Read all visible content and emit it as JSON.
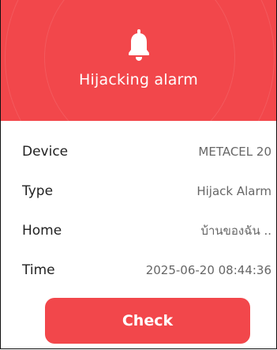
{
  "header": {
    "icon": "bell-icon",
    "title": "Hijacking alarm",
    "color": "#f2474b"
  },
  "details": {
    "device": {
      "label": "Device",
      "value": "METACEL 20"
    },
    "type": {
      "label": "Type",
      "value": "Hijack Alarm"
    },
    "home": {
      "label": "Home",
      "value": "บ้านของฉัน .."
    },
    "time": {
      "label": "Time",
      "value": "2025-06-20 08:44:36"
    }
  },
  "actions": {
    "check_label": "Check"
  }
}
